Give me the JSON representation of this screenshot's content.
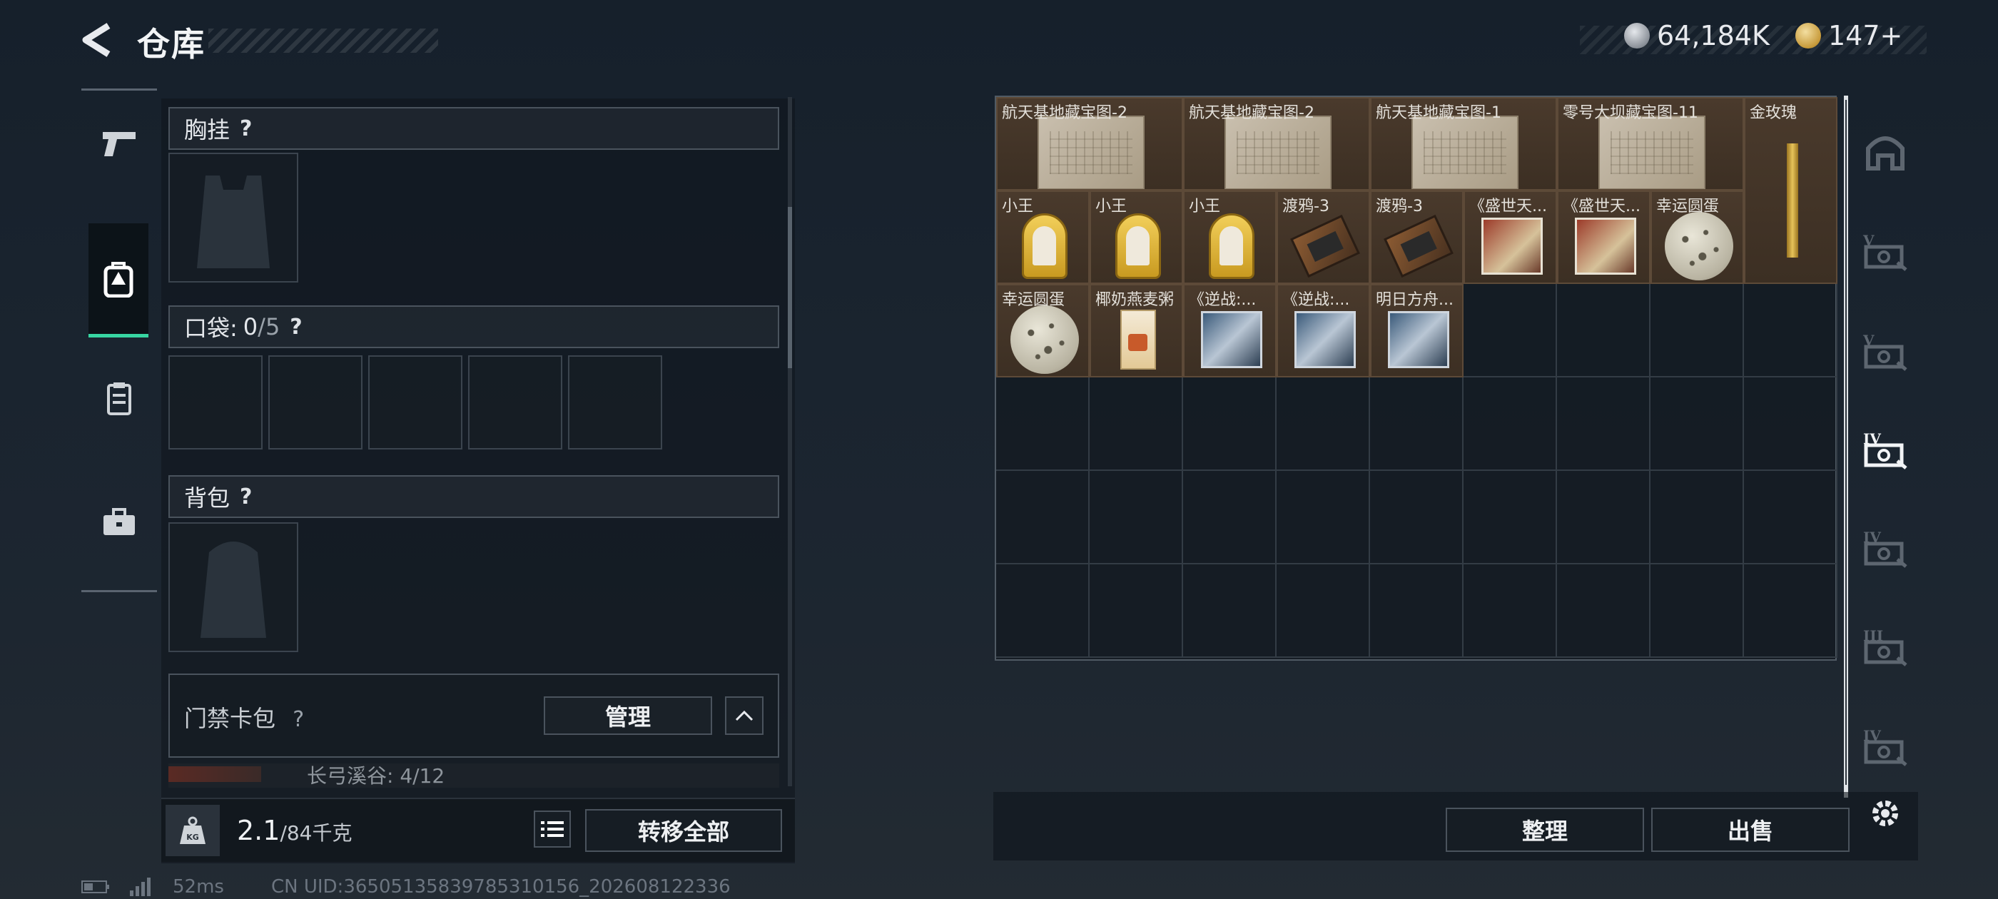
{
  "header": {
    "title": "仓库",
    "currency_silver": "64,184K",
    "currency_gold": "147+"
  },
  "left_nav": [
    {
      "name": "weapons",
      "icon": "pistol-icon"
    },
    {
      "name": "equipment",
      "icon": "backpack-icon",
      "active": true
    },
    {
      "name": "supplies",
      "icon": "clipboard-icon"
    },
    {
      "name": "toolkit",
      "icon": "briefcase-icon"
    }
  ],
  "sections": {
    "chest_rig": {
      "label": "胸挂",
      "help": "?"
    },
    "pocket": {
      "label": "口袋:",
      "count": "0",
      "capacity": "/5",
      "help": "?"
    },
    "backpack": {
      "label": "背包",
      "help": "?"
    },
    "keycard": {
      "label": "门禁卡包",
      "help": "?",
      "manage": "管理",
      "sub": "长弓溪谷: 4/12"
    }
  },
  "weight": {
    "current": "2.1",
    "max": "/84千克",
    "unit_icon": "KG"
  },
  "buttons": {
    "transfer_all": "转移全部",
    "sort": "整理",
    "sell": "出售"
  },
  "items": [
    {
      "name": "航天基地藏宝图-2",
      "type": "map"
    },
    {
      "name": "航天基地藏宝图-2",
      "type": "map"
    },
    {
      "name": "航天基地藏宝图-1",
      "type": "map"
    },
    {
      "name": "零号大坝藏宝图-11",
      "type": "map"
    },
    {
      "name": "金玫瑰",
      "type": "rose"
    },
    {
      "name": "小王",
      "type": "badge"
    },
    {
      "name": "小王",
      "type": "badge"
    },
    {
      "name": "小王",
      "type": "badge"
    },
    {
      "name": "渡鸦-3",
      "type": "tape"
    },
    {
      "name": "渡鸦-3",
      "type": "tape"
    },
    {
      "name": "《盛世天...",
      "type": "album"
    },
    {
      "name": "《盛世天...",
      "type": "album"
    },
    {
      "name": "幸运圆蛋",
      "type": "egg"
    },
    {
      "name": "幸运圆蛋",
      "type": "egg"
    },
    {
      "name": "椰奶燕麦粥",
      "type": "cereal"
    },
    {
      "name": "《逆战:...",
      "type": "cd"
    },
    {
      "name": "《逆战:...",
      "type": "cd"
    },
    {
      "name": "明日方舟...",
      "type": "cd"
    }
  ],
  "right_tabs": [
    "all-tab",
    "v-tier-tab",
    "v-tier-tab-2",
    "iv-tier-tab",
    "iv-tier-tab-2",
    "iii-tier-tab",
    "iv-tier-tab-3"
  ],
  "status": {
    "ping": "52ms",
    "uid": "CN UID:36505135839785310156_202608122336"
  }
}
